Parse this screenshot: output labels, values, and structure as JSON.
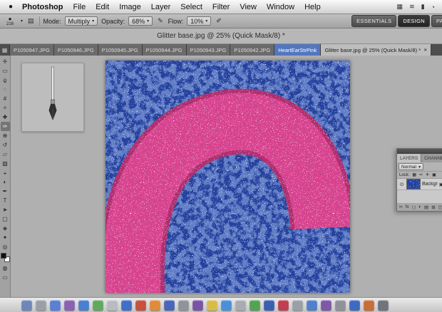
{
  "icons": {
    "apple": "●",
    "caret": "▾",
    "close": "✕",
    "grid": "▦",
    "wifi": "≋",
    "battery": "▮",
    "clock": "◔",
    "panel_toggle": "▤",
    "brush_dot": "●",
    "tablet": "✎",
    "airbrush": "✐",
    "eye": "⊙",
    "lock": "▣",
    "lock_transparency": "▦",
    "lock_image": "✑",
    "lock_position": "✛",
    "lock_all": "▣",
    "link": "∞",
    "fx": "fx",
    "mask": "◻",
    "adjust": "◐",
    "folder": "▤",
    "new_layer": "⊞",
    "trash": "◫",
    "quick_mask": "◍",
    "screen_mode": "▭"
  },
  "menu_bar": {
    "items": [
      "Photoshop",
      "File",
      "Edit",
      "Image",
      "Layer",
      "Select",
      "Filter",
      "View",
      "Window",
      "Help"
    ]
  },
  "options_bar": {
    "brush_size": "216",
    "mode_label": "Mode:",
    "mode_value": "Multiply",
    "opacity_label": "Opacity:",
    "opacity_value": "68%",
    "flow_label": "Flow:",
    "flow_value": "10%",
    "workspaces": [
      {
        "label": "ESSENTIALS"
      },
      {
        "label": "DESIGN"
      },
      {
        "label": "PAINT"
      }
    ]
  },
  "window": {
    "title": "Glitter base.jpg @ 25% (Quick Mask/8) *"
  },
  "tabs": [
    {
      "label": "P1050947.JPG"
    },
    {
      "label": "P1050946.JPG"
    },
    {
      "label": "P1050945.JPG"
    },
    {
      "label": "P1050944.JPG"
    },
    {
      "label": "P1050943.JPG"
    },
    {
      "label": "P1050942.JPG"
    },
    {
      "label": "HeartEarStrPink"
    },
    {
      "label": "Glitter base.jpg @ 25% (Quick Mask/8) *"
    }
  ],
  "toolbar": {
    "tools": [
      {
        "name": "move",
        "glyph": "✛"
      },
      {
        "name": "marquee",
        "glyph": "▭"
      },
      {
        "name": "lasso",
        "glyph": "ϱ"
      },
      {
        "name": "quick-selection",
        "glyph": "◌"
      },
      {
        "name": "crop",
        "glyph": "#"
      },
      {
        "name": "eyedropper",
        "glyph": "✧"
      },
      {
        "name": "healing-brush",
        "glyph": "✚"
      },
      {
        "name": "brush",
        "glyph": "✑"
      },
      {
        "name": "clone-stamp",
        "glyph": "⊕"
      },
      {
        "name": "history-brush",
        "glyph": "↺"
      },
      {
        "name": "eraser",
        "glyph": "▱"
      },
      {
        "name": "gradient",
        "glyph": "▨"
      },
      {
        "name": "blur",
        "glyph": "◒"
      },
      {
        "name": "dodge",
        "glyph": "◐"
      },
      {
        "name": "pen",
        "glyph": "✒"
      },
      {
        "name": "type",
        "glyph": "T"
      },
      {
        "name": "path-selection",
        "glyph": "➤"
      },
      {
        "name": "shape",
        "glyph": "▢"
      },
      {
        "name": "3d-rotate",
        "glyph": "◈"
      },
      {
        "name": "hand",
        "glyph": "✦"
      },
      {
        "name": "zoom",
        "glyph": "◎"
      }
    ]
  },
  "canvas": {
    "blue": "#24419e",
    "blue_light": "#4a6fd0",
    "pink": "#d8438f",
    "pink_dark": "#b02e6e",
    "zoom": "25%"
  },
  "layers_panel": {
    "tabs": [
      "LAYERS",
      "CHANNELS"
    ],
    "blend_mode": "Normal",
    "lock_label": "Lock:",
    "layers": [
      {
        "name": "Background"
      }
    ]
  },
  "dock": {
    "items": [
      {
        "color": "#6f87b8"
      },
      {
        "color": "#9aa0a8"
      },
      {
        "color": "#5b7fd4"
      },
      {
        "color": "#8a62b0"
      },
      {
        "color": "#4a7fd0"
      },
      {
        "color": "#62a85e"
      },
      {
        "color": "#b8bcc2"
      },
      {
        "color": "#3f6fc8"
      },
      {
        "color": "#c8503f"
      },
      {
        "color": "#e08a3c"
      },
      {
        "color": "#4a66b8"
      },
      {
        "color": "#90949a"
      },
      {
        "color": "#7a54a4"
      },
      {
        "color": "#d8bc48"
      },
      {
        "color": "#4a90d8"
      },
      {
        "color": "#a8acb2"
      },
      {
        "color": "#52a452"
      },
      {
        "color": "#3c60b0"
      },
      {
        "color": "#c23e52"
      },
      {
        "color": "#9aa0a6"
      },
      {
        "color": "#5080cc"
      },
      {
        "color": "#8058a8"
      },
      {
        "color": "#90929a"
      },
      {
        "color": "#3e6ac2"
      },
      {
        "color": "#c86e38"
      },
      {
        "color": "#70747c"
      }
    ]
  }
}
